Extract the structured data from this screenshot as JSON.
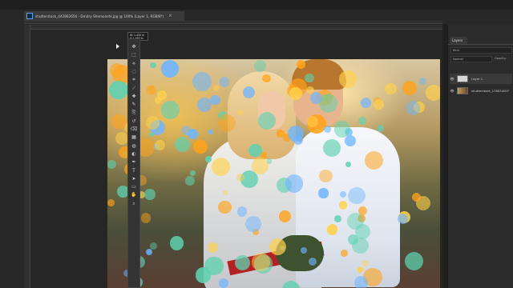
{
  "document": {
    "tab_title": "shutterstock_442862656 - Dmitry Shemonets.jpg @ 100% (Layer 1, RGB/8*)",
    "tab_close": "×"
  },
  "readout": {
    "line1": "W: 1.420 in",
    "line2": "Y: 1.493 in"
  },
  "tools": [
    "move-tool",
    "marquee-tool",
    "lasso-tool",
    "quick-select-tool",
    "crop-tool",
    "eyedropper-tool",
    "healing-tool",
    "brush-tool",
    "clone-stamp-tool",
    "history-brush-tool",
    "eraser-tool",
    "gradient-tool",
    "blur-tool",
    "dodge-tool",
    "pen-tool",
    "type-tool",
    "path-select-tool",
    "rectangle-tool",
    "hand-tool",
    "zoom-tool"
  ],
  "tool_glyphs": [
    "✥",
    "⬚",
    "⟡",
    "◌",
    "⌗",
    "⟋",
    "✚",
    "✎",
    "⎘",
    "↺",
    "⌫",
    "▦",
    "◍",
    "◐",
    "✒",
    "T",
    "➤",
    "▭",
    "✋",
    "⌕"
  ],
  "layers_panel": {
    "tab_label": "Layers",
    "kind_filter": "Kind",
    "blend_mode": "Normal",
    "opacity_label": "Opacity:",
    "layers": [
      {
        "name": "Layer 1",
        "visible": true,
        "selected": true
      },
      {
        "name": "shutterstock_17803400?",
        "visible": true,
        "selected": false
      }
    ],
    "eye_glyph": "👁"
  },
  "colors": {
    "bokeh_orange": "#ffa31a",
    "bokeh_yellow": "#ffd24a",
    "bokeh_teal": "#5fd1b0",
    "bokeh_blue": "#6fb6ff"
  }
}
